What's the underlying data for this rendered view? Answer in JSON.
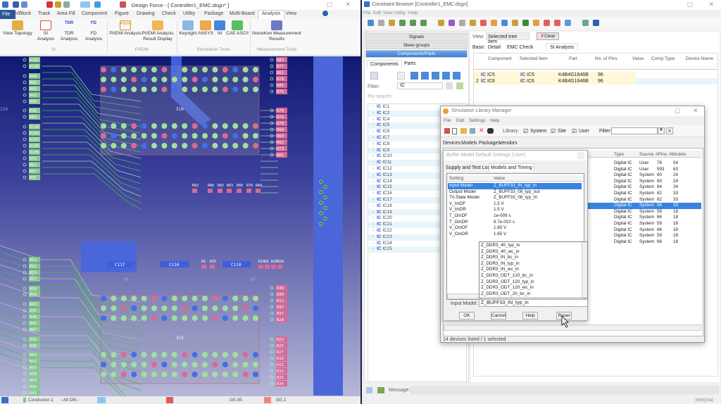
{
  "design_force": {
    "title": "Design Force - [ Controller1_EMC.dsgn* ]",
    "tabs": [
      "File",
      "n/Block",
      "Track",
      "Area Fill",
      "Component",
      "Figure",
      "Drawing",
      "Check",
      "Utility",
      "Package",
      "Multi-Board",
      "Analysis",
      "View"
    ],
    "active_tab": "Analysis",
    "ribbon": [
      {
        "label": "View Topology",
        "group": "SI"
      },
      {
        "label": "SI Analysis",
        "group": "SI"
      },
      {
        "label": "TDR Analysis",
        "group": "SI"
      },
      {
        "label": "FD Analysis",
        "group": "SI"
      },
      {
        "label": "PI/EMI Analysis",
        "group": "PI/EMI"
      },
      {
        "label": "PI/EMI Analysis Result Display",
        "group": "PI/EMI"
      },
      {
        "label": "Keysight",
        "group": "Simulation Tools"
      },
      {
        "label": "ANSYS",
        "group": "Simulation Tools"
      },
      {
        "label": "NI",
        "group": "Simulation Tools"
      },
      {
        "label": "CAE ASCII",
        "group": "Simulation Tools"
      },
      {
        "label": "NoiseKen Measurement Results",
        "group": "Measurement Tools"
      }
    ],
    "groups": [
      "SI",
      "PI/EMI",
      "Simulation Tools",
      "Measurement Tools"
    ],
    "icon_text": {
      "tdr": "TDR",
      "fd": "FD",
      "piemi": "PI/EMI"
    },
    "pcb": {
      "components": [
        "IC6",
        "IC5",
        "C117",
        "C116",
        "C118"
      ],
      "left_labels": [
        "R101",
        "R100",
        "R94",
        "R96",
        "R99",
        "R92",
        "R98",
        "R90",
        "R89",
        "R110",
        "R103",
        "R107",
        "R109",
        "R105",
        "R91",
        "R93",
        "R97",
        "R95",
        "R53",
        "R51",
        "R55",
        "R57",
        "R50",
        "R49",
        "R43",
        "R45",
        "R48",
        "R41",
        "R47",
        "R39",
        "R38",
        "R59",
        "R52",
        "R56",
        "R58",
        "R54",
        "R40",
        "R42"
      ],
      "right_labels": [
        "R83",
        "R77",
        "R61",
        "R79",
        "R85",
        "R75",
        "R74",
        "R76",
        "R78",
        "R69",
        "R60",
        "R62",
        "R73",
        "R81",
        "R36",
        "R30",
        "R12",
        "R32",
        "R37",
        "R28",
        "R23",
        "R25",
        "R27",
        "R18",
        "R11",
        "R13",
        "R26",
        "R34"
      ],
      "bottom_labels": [
        "R82",
        "R80",
        "R65",
        "R63",
        "R66",
        "R70",
        "R84",
        "R2",
        "R35",
        "R10",
        "R1",
        "R20",
        "R24"
      ],
      "faint_labels": [
        "110",
        "50",
        "60"
      ]
    },
    "status": {
      "layer": "Conductor-1",
      "filter": "- All ON -",
      "grid1": "G0.05",
      "grid2": "G0.1"
    }
  },
  "constraint_browser": {
    "title": "Constraint Browser [Controller1_EMC.dsgn]",
    "menu": [
      "File",
      "Edit",
      "View",
      "Utility",
      "Help"
    ],
    "accordion": [
      "Signals",
      "Skew groups",
      "Components/Parts"
    ],
    "left_tabs": [
      "Components",
      "Parts"
    ],
    "filter_label": "Filter:",
    "filter_value": "IC",
    "pin_search_label": "Pin search:",
    "tree": [
      "IC1",
      "IC2",
      "IC4",
      "IC5",
      "IC6",
      "IC7",
      "IC8",
      "IC9",
      "IC10",
      "IC11",
      "IC12",
      "IC13",
      "IC14",
      "IC15",
      "IC16",
      "IC17",
      "IC18",
      "IC19",
      "IC20",
      "IC21",
      "IC22",
      "IC23",
      "IC24",
      "IC25"
    ],
    "ic_badge": "IC",
    "view_label": "View:",
    "view_value": "Selected tree item",
    "clear_label": "Clear",
    "tabs": [
      "Basic",
      "Detail",
      "EMC Check",
      "SI Analysis"
    ],
    "active_tab": "SI Analysis",
    "columns": [
      "Component",
      "Selected Item",
      "Part",
      "No. of Pins",
      "Value",
      "Comp Type",
      "Device Name"
    ],
    "rows": [
      {
        "num": "",
        "component": "IC5",
        "selected": "IC5",
        "part": "K4B4G1646B",
        "pins": "96"
      },
      {
        "num": "2",
        "component": "IC6",
        "selected": "IC6",
        "part": "K4B4G1646B",
        "pins": "96"
      }
    ],
    "message_label": "Message:",
    "units": "[mm]  [ns]"
  },
  "sim_lib": {
    "title": "Simulation Library Manager",
    "menu": [
      "File",
      "Edit",
      "Settings",
      "Help"
    ],
    "library_label": "Library:",
    "checks": [
      {
        "label": "System",
        "checked": true
      },
      {
        "label": "Site",
        "checked": true
      },
      {
        "label": "User",
        "checked": true
      }
    ],
    "filter_label": "Filter:",
    "filter_value": "",
    "clear_btn": "X",
    "tabs": [
      "Devices",
      "Models",
      "Packages",
      "Vendors"
    ],
    "columns": [
      "Type",
      "Source",
      "#Pins",
      "#Models"
    ],
    "rows": [
      [
        "Digital IC",
        "User",
        "78",
        "54"
      ],
      [
        "Digital IC",
        "User",
        "593",
        "63"
      ],
      [
        "Digital IC",
        "System",
        "60",
        "24"
      ],
      [
        "Digital IC",
        "System",
        "60",
        "24"
      ],
      [
        "Digital IC",
        "System",
        "84",
        "24"
      ],
      [
        "Digital IC",
        "System",
        "82",
        "33"
      ],
      [
        "Digital IC",
        "System",
        "82",
        "33"
      ],
      [
        "Digital IC",
        "System",
        "96",
        "33"
      ],
      [
        "Digital IC",
        "System",
        "59",
        "18"
      ],
      [
        "Digital IC",
        "System",
        "66",
        "18"
      ],
      [
        "Digital IC",
        "System",
        "59",
        "18"
      ],
      [
        "Digital IC",
        "System",
        "66",
        "18"
      ],
      [
        "Digital IC",
        "System",
        "59",
        "18"
      ],
      [
        "Digital IC",
        "System",
        "66",
        "18"
      ]
    ],
    "selected_row": 7,
    "status": "14 devices listed / 1 selected"
  },
  "buffer_dialog": {
    "title": "Buffer Model Default Settings   (User)",
    "tabs": [
      "Supply and Test Load",
      "Models and Timing"
    ],
    "active_tab": "Models and Timing",
    "columns": [
      "Setting",
      "Value"
    ],
    "rows": [
      [
        "Input Model",
        "Z_BUFF33_IN_typ_in"
      ],
      [
        "Output Model",
        "Z_BUFF33_08_typ_out"
      ],
      [
        "Tri-State Model",
        "Z_BUFF33_08_typ_tri"
      ],
      [
        "V_ImDF",
        "1.5 V"
      ],
      [
        "V_ImDR",
        "1.5 V"
      ],
      [
        "T_OmDF",
        "1e-009 s"
      ],
      [
        "T_OmDR",
        "6.7e-010 s"
      ],
      [
        "V_OmDF",
        "1.65 V"
      ],
      [
        "V_OmDR",
        "1.65 V"
      ]
    ],
    "selected_row": 0,
    "dropdown_options": [
      "Z_DDR3_40_typ_in",
      "Z_DDR3_40_wc_in",
      "Z_DDR3_IN_bc_in",
      "Z_DDR3_IN_typ_in",
      "Z_DDR3_IN_wc_in",
      "Z_DDR3_ODT_120_bc_in",
      "Z_DDR3_ODT_120_typ_in",
      "Z_DDR3_ODT_120_wc_in",
      "Z_DDR3_ODT_20_bc_in"
    ],
    "input_model_label": "Input Model:",
    "input_model_value": "Z_BUFF33_IN_typ_in",
    "buttons": [
      "OK",
      "Cancel",
      "Help",
      "Reset"
    ]
  }
}
